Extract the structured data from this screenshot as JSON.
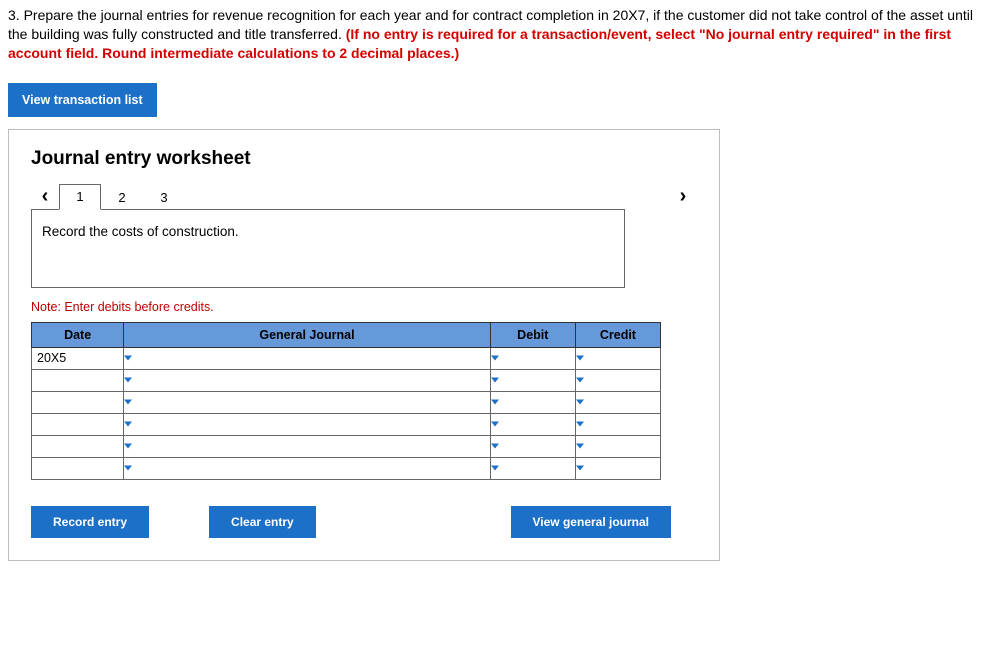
{
  "question": {
    "prefix": "3. Prepare the journal entries for revenue recognition for each year and for contract completion in 20X7, if the customer did not take control of the asset until the building was fully constructed and title transferred. ",
    "red": "(If no entry is required for a transaction/event, select \"No journal entry required\" in the first account field. Round intermediate calculations to 2 decimal places.)"
  },
  "buttons": {
    "view_list": "View transaction list",
    "record": "Record entry",
    "clear": "Clear entry",
    "view_journal": "View general journal"
  },
  "worksheet": {
    "title": "Journal entry worksheet",
    "tabs": [
      "1",
      "2",
      "3"
    ],
    "active_tab": 0,
    "instruction": "Record the costs of construction.",
    "note": "Note: Enter debits before credits.",
    "headers": {
      "date": "Date",
      "gj": "General Journal",
      "debit": "Debit",
      "credit": "Credit"
    },
    "rows": [
      {
        "date": "20X5",
        "gj": "",
        "debit": "",
        "credit": ""
      },
      {
        "date": "",
        "gj": "",
        "debit": "",
        "credit": ""
      },
      {
        "date": "",
        "gj": "",
        "debit": "",
        "credit": ""
      },
      {
        "date": "",
        "gj": "",
        "debit": "",
        "credit": ""
      },
      {
        "date": "",
        "gj": "",
        "debit": "",
        "credit": ""
      },
      {
        "date": "",
        "gj": "",
        "debit": "",
        "credit": ""
      }
    ]
  },
  "icons": {
    "chev_left": "‹",
    "chev_right": "›"
  }
}
